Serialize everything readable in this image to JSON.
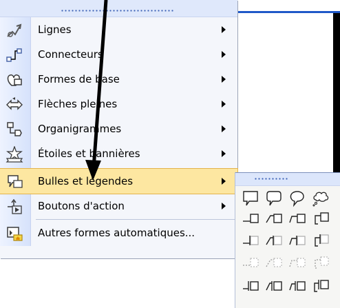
{
  "menu": {
    "items": [
      {
        "label": "Lignes",
        "icon": "lines-icon",
        "has_submenu": true
      },
      {
        "label": "Connecteurs",
        "icon": "connectors-icon",
        "has_submenu": true
      },
      {
        "label": "Formes de base",
        "icon": "basic-shapes-icon",
        "has_submenu": true
      },
      {
        "label": "Flèches pleines",
        "icon": "block-arrows-icon",
        "has_submenu": true
      },
      {
        "label": "Organigrammes",
        "icon": "flowchart-icon",
        "has_submenu": true
      },
      {
        "label": "Étoiles et bannières",
        "icon": "stars-banners-icon",
        "has_submenu": true
      },
      {
        "label": "Bulles et légendes",
        "icon": "callouts-icon",
        "has_submenu": true,
        "active": true
      },
      {
        "label": "Boutons d'action",
        "icon": "action-buttons-icon",
        "has_submenu": true
      },
      {
        "label": "Autres formes automatiques...",
        "icon": "more-autoshapes-icon",
        "has_submenu": false
      }
    ]
  },
  "submenu": {
    "title": "Bulles et légendes",
    "rows": [
      [
        "rectangular-callout-icon",
        "rounded-callout-icon",
        "oval-callout-icon",
        "cloud-callout-icon"
      ],
      [
        "line-callout-1-icon",
        "line-callout-2-icon",
        "line-callout-3-icon",
        "line-callout-4-icon"
      ],
      [
        "line-callout-1-accent-icon",
        "line-callout-2-accent-icon",
        "line-callout-3-accent-icon",
        "line-callout-4-accent-icon"
      ],
      [
        "line-callout-1-noborder-icon",
        "line-callout-2-noborder-icon",
        "line-callout-3-noborder-icon",
        "line-callout-4-noborder-icon"
      ],
      [
        "line-callout-1-border-accent-icon",
        "line-callout-2-border-accent-icon",
        "line-callout-3-border-accent-icon",
        "line-callout-4-border-accent-icon"
      ]
    ]
  },
  "colors": {
    "menu_bg": "#f4f6fb",
    "gutter": "#d6e2fb",
    "active_bg": "#fde7a1",
    "active_border": "#e3b34b",
    "title_bar": "#1f58c8"
  }
}
